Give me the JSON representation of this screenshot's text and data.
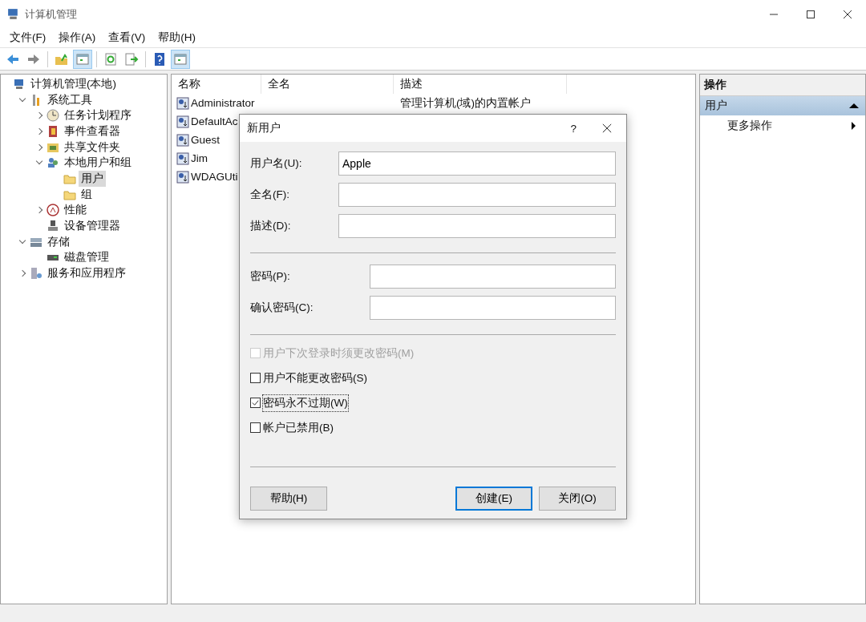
{
  "window": {
    "title": "计算机管理"
  },
  "menu": [
    {
      "label": "文件(F)"
    },
    {
      "label": "操作(A)"
    },
    {
      "label": "查看(V)"
    },
    {
      "label": "帮助(H)"
    }
  ],
  "toolbar": [
    {
      "kind": "back",
      "pressed": false
    },
    {
      "kind": "forward",
      "pressed": false
    },
    {
      "kind": "sep"
    },
    {
      "kind": "up",
      "pressed": false
    },
    {
      "kind": "tree",
      "pressed": true
    },
    {
      "kind": "sep"
    },
    {
      "kind": "refresh",
      "pressed": false
    },
    {
      "kind": "export",
      "pressed": false
    },
    {
      "kind": "sep"
    },
    {
      "kind": "help",
      "pressed": false
    },
    {
      "kind": "pane",
      "pressed": true
    }
  ],
  "tree": [
    {
      "label": "计算机管理(本地)",
      "kind": "computer",
      "selected": false,
      "children": [
        {
          "label": "系统工具",
          "kind": "tools",
          "expanded": true,
          "selected": false,
          "children": [
            {
              "label": "任务计划程序",
              "kind": "clock",
              "expanded": false,
              "selected": false
            },
            {
              "label": "事件查看器",
              "kind": "event",
              "expanded": false,
              "selected": false
            },
            {
              "label": "共享文件夹",
              "kind": "share",
              "expanded": false,
              "selected": false
            },
            {
              "label": "本地用户和组",
              "kind": "users",
              "expanded": true,
              "selected": false,
              "children": [
                {
                  "label": "用户",
                  "kind": "folder",
                  "selected": true
                },
                {
                  "label": "组",
                  "kind": "folder",
                  "selected": false
                }
              ]
            },
            {
              "label": "性能",
              "kind": "perf",
              "expanded": false,
              "selected": false
            },
            {
              "label": "设备管理器",
              "kind": "device",
              "selected": false
            }
          ]
        },
        {
          "label": "存储",
          "kind": "storage",
          "expanded": true,
          "selected": false,
          "children": [
            {
              "label": "磁盘管理",
              "kind": "disk",
              "selected": false
            }
          ]
        },
        {
          "label": "服务和应用程序",
          "kind": "services",
          "expanded": false,
          "selected": false
        }
      ]
    }
  ],
  "list": {
    "columns": [
      "名称",
      "全名",
      "描述"
    ],
    "rows": [
      {
        "name": "Administrator",
        "description": "管理计算机(域)的内置帐户"
      },
      {
        "name": "DefaultAc"
      },
      {
        "name": "Guest"
      },
      {
        "name": "Jim"
      },
      {
        "name": "WDAGUti"
      }
    ]
  },
  "actions": {
    "header": "操作",
    "section": {
      "label": "用户",
      "expanded": true
    },
    "items": [
      {
        "label": "更多操作"
      }
    ]
  },
  "dialog": {
    "title": "新用户",
    "help": "?",
    "field_groups": [
      [
        {
          "label": "用户名(U):",
          "value": "Apple"
        },
        {
          "label": "全名(F):"
        },
        {
          "label": "描述(D):"
        }
      ],
      [
        {
          "label": "密码(P):"
        },
        {
          "label": "确认密码(C):"
        }
      ]
    ],
    "checkboxes": [
      {
        "label": "用户下次登录时须更改密码(M)",
        "checked": false,
        "disabled": true,
        "focused": false
      },
      {
        "label": "用户不能更改密码(S)",
        "checked": false,
        "disabled": false,
        "focused": false
      },
      {
        "label": "密码永不过期(W)",
        "checked": true,
        "disabled": false,
        "focused": true
      },
      {
        "label": "帐户已禁用(B)",
        "checked": false,
        "disabled": false,
        "focused": false
      }
    ],
    "buttons": [
      {
        "label": "帮助(H)",
        "default": false
      },
      {
        "label": "创建(E)",
        "default": true
      },
      {
        "label": "关闭(O)",
        "default": false
      }
    ]
  }
}
